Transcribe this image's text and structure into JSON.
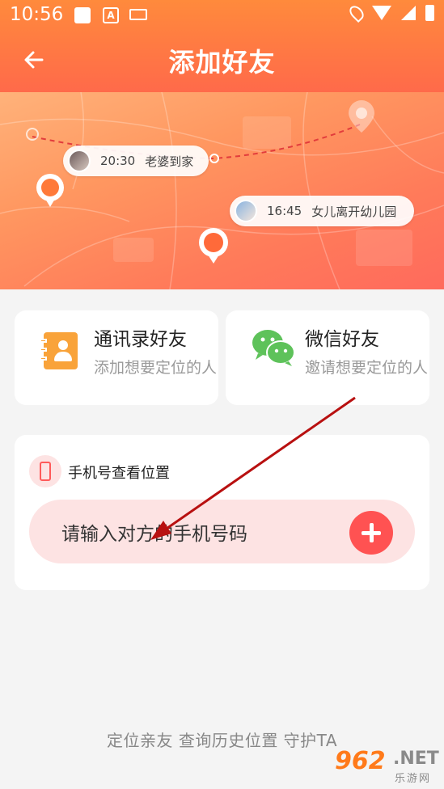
{
  "status_bar": {
    "time": "10:56",
    "a_badge": "A"
  },
  "header": {
    "back_icon": "arrow-left-icon",
    "title": "添加好友"
  },
  "banner": {
    "events": [
      {
        "time": "20:30",
        "text": "老婆到家"
      },
      {
        "time": "16:45",
        "text": "女儿离开幼儿园"
      }
    ]
  },
  "options": [
    {
      "icon": "contacts-book-icon",
      "title": "通讯录好友",
      "subtitle": "添加想要定位的人"
    },
    {
      "icon": "wechat-icon",
      "title": "微信好友",
      "subtitle": "邀请想要定位的人"
    }
  ],
  "phone_lookup": {
    "label": "手机号查看位置",
    "placeholder": "请输入对方的手机号码",
    "add_icon": "plus-icon"
  },
  "slogan": "定位亲友  查询历史位置  守护TA",
  "watermark": {
    "number": "962",
    "suffix": ".NET",
    "subtitle": "乐游网"
  },
  "colors": {
    "header_gradient_top": "#ff8a3c",
    "header_gradient_bottom": "#ff6a4a",
    "accent_red": "#ff5252",
    "contacts_orange": "#f9a33a",
    "wechat_green": "#5ec25a",
    "input_pink": "#fde3e3",
    "annotation_arrow": "#cc1111"
  }
}
